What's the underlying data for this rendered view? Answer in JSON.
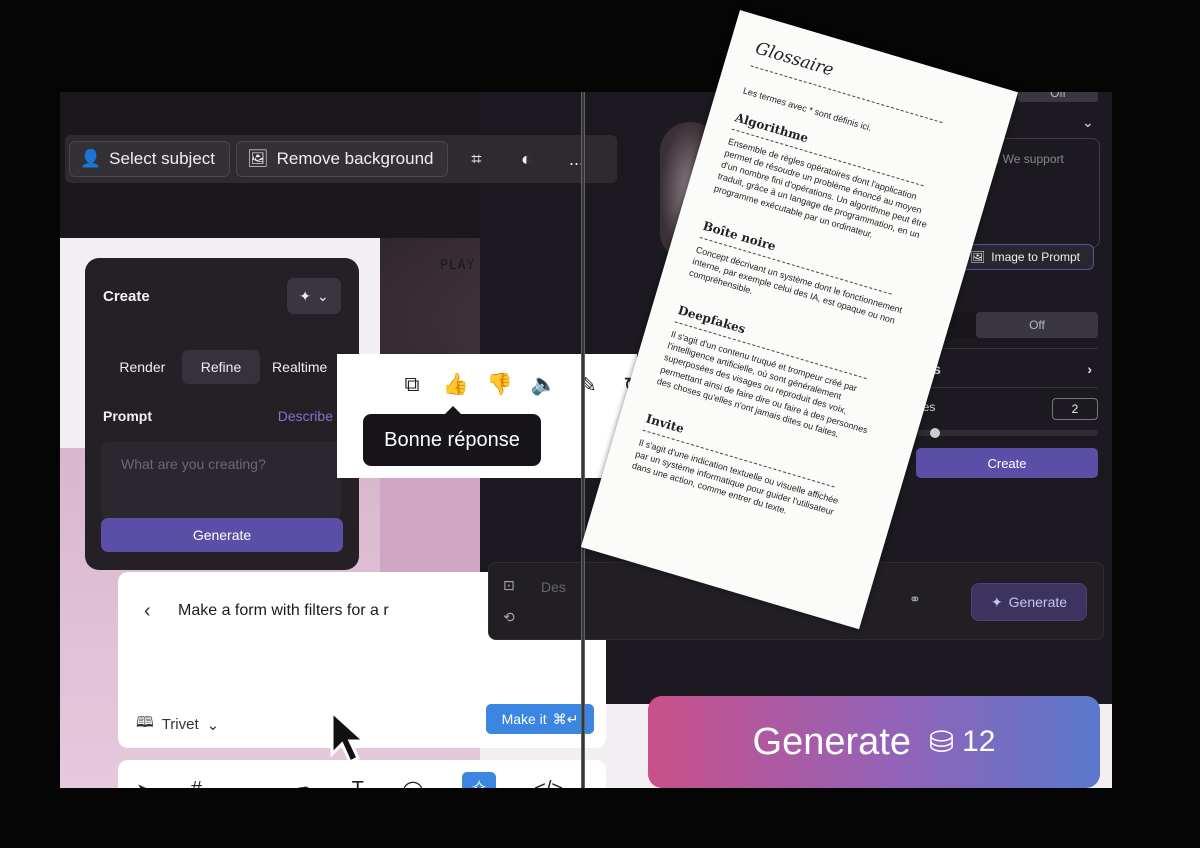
{
  "toolbar": {
    "select_subject": "Select subject",
    "remove_background": "Remove background",
    "more": "..."
  },
  "photo_text": "PLAY SYSTEM",
  "create_card": {
    "title": "Create",
    "tabs": [
      "Render",
      "Refine",
      "Realtime"
    ],
    "active_tab": "Refine",
    "prompt_label": "Prompt",
    "describe_link": "Describe",
    "prompt_placeholder": "What are you creating?",
    "generate_label": "Generate"
  },
  "feedback": {
    "tooltip": "Bonne réponse",
    "icons": [
      "copy-icon",
      "thumbs-up-icon",
      "thumbs-down-icon",
      "speaker-icon",
      "edit-sparkle-icon",
      "retry-icon"
    ]
  },
  "form_card": {
    "input_text": "Make a form with filters for a r",
    "library_label": "Trivet",
    "make_it_label": "Make it",
    "shortcut": "⌘↵"
  },
  "right_panel": {
    "off_top": "Off",
    "support_text": "ble. We support",
    "image_to_prompt": "Image to Prompt",
    "toggle_off": "Off",
    "settings_label": "ngs",
    "images_label": "ges",
    "images_count": "2",
    "create_label": "Create",
    "describe_placeholder": "Des",
    "generate_label": "Generate"
  },
  "big_generate": {
    "label": "Generate",
    "credits": "12"
  },
  "glossary": {
    "title": "Glossaire",
    "intro": "Les termes avec * sont définis ici.",
    "entries": [
      {
        "term": "Algorithme",
        "definition": "Ensemble de règles opératoires dont l'application permet de résoudre un problème énoncé au moyen d'un nombre fini d'opérations. Un algorithme peut être traduit, grâce à un langage de programmation, en un programme exécutable par un ordinateur."
      },
      {
        "term": "Boîte noire",
        "definition": "Concept décrivant un système dont le fonctionnement interne, par exemple celui des IA, est opaque ou non compréhensible."
      },
      {
        "term": "Deepfakes",
        "definition": "Il s'agit d'un contenu truqué et trompeur créé par l'intelligence artificielle, où sont généralement superposées des visages ou reproduit des voix, permettant ainsi de faire dire ou faire à des personnes des choses qu'elles n'ont jamais dites ou faites."
      },
      {
        "term": "Invite",
        "definition": "Il s'agit d'une indication textuelle ou visuelle affichée par un système informatique pour guider l'utilisateur dans une action, comme entrer du texte."
      }
    ]
  }
}
